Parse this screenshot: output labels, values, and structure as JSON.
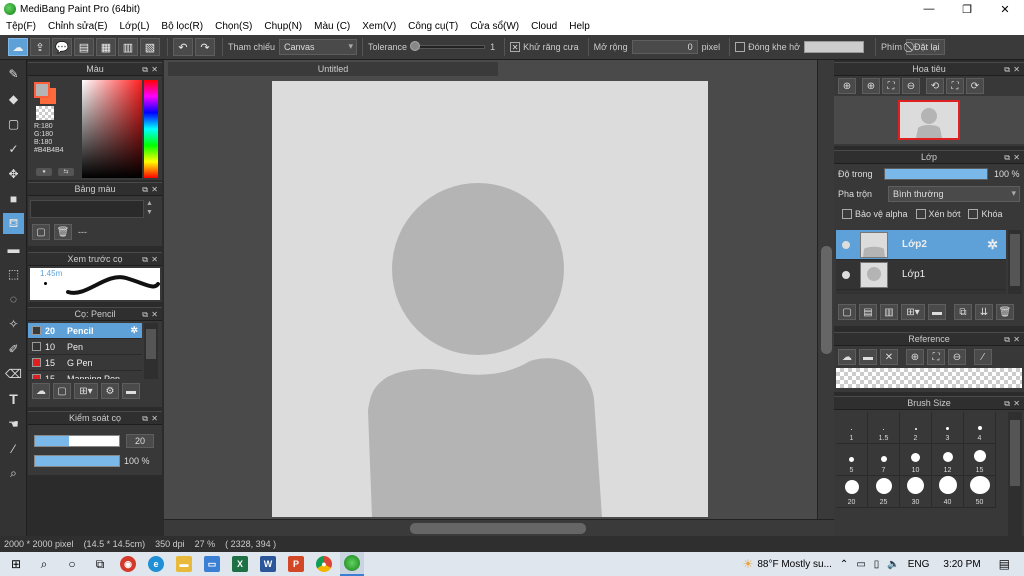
{
  "window": {
    "title": "MediBang Paint Pro (64bit)",
    "controls": [
      "—",
      "❐",
      "✕"
    ]
  },
  "menu": [
    "Tệp(F)",
    "Chỉnh sửa(E)",
    "Lớp(L)",
    "Bộ lọc(R)",
    "Chọn(S)",
    "Chụp(N)",
    "Màu (C)",
    "Xem(V)",
    "Công cụ(T)",
    "Cửa sổ(W)",
    "Cloud",
    "Help"
  ],
  "toolbar": {
    "ref_label": "Tham chiếu",
    "ref_value": "Canvas",
    "tolerance_label": "Tolerance",
    "tolerance_value": "1",
    "antialias_label": "Khử răng cưa",
    "expand_label": "Mở rộng",
    "expand_value": "0",
    "expand_unit": "pixel",
    "gap_label": "Đóng khe hở",
    "key_label": "Phím",
    "reset_label": "Đặt lại"
  },
  "panels": {
    "color": {
      "title": "Màu",
      "r": "R:180",
      "g": "G:180",
      "b": "B:180",
      "hex": "#B4B4B4",
      "fg_color": "#b4b4b4",
      "bg_color": "#ff6a3a"
    },
    "palette": {
      "title": "Bảng màu",
      "footer": "---"
    },
    "brush_preview": {
      "title": "Xem trước cọ",
      "size": "1.45m"
    },
    "brush": {
      "title": "Cọ: Pencil",
      "items": [
        {
          "size": "20",
          "name": "Pencil",
          "color": "#3a3a3a",
          "active": true
        },
        {
          "size": "10",
          "name": "Pen",
          "color": "#333333",
          "active": false
        },
        {
          "size": "15",
          "name": "G Pen",
          "color": "#e02020",
          "active": false
        },
        {
          "size": "15",
          "name": "Mapping Pen",
          "color": "#e02020",
          "active": false
        }
      ]
    },
    "brush_control": {
      "title": "Kiểm soát cọ",
      "size_value": "20",
      "opacity_value": "100 %",
      "size_fraction": 0.4,
      "opacity_fraction": 1.0
    }
  },
  "canvas": {
    "tab_title": "Untitled"
  },
  "right": {
    "navigator": {
      "title": "Hoa tiêu"
    },
    "layer": {
      "title": "Lớp",
      "opacity_label": "Độ trong",
      "opacity_value": "100 %",
      "blend_label": "Pha trộn",
      "blend_value": "Bình thường",
      "protect_alpha": "Bảo vệ alpha",
      "clipping": "Xén bớt",
      "lock": "Khóa",
      "layers": [
        {
          "name": "Lớp2",
          "active": true
        },
        {
          "name": "Lớp1",
          "active": false
        }
      ]
    },
    "reference": {
      "title": "Reference"
    },
    "brush_size": {
      "title": "Brush Size",
      "sizes": [
        "1",
        "1.5",
        "2",
        "3",
        "4",
        "5",
        "7",
        "10",
        "12",
        "15",
        "20",
        "25",
        "30",
        "40",
        "50"
      ]
    }
  },
  "status": {
    "dimensions": "2000 * 2000 pixel",
    "physical": "(14.5 * 14.5cm)",
    "dpi": "350 dpi",
    "zoom": "27 %",
    "coords": "( 2328, 394 )"
  },
  "taskbar": {
    "weather": "88°F  Mostly su...",
    "lang": "ENG",
    "time": "3:20 PM"
  }
}
